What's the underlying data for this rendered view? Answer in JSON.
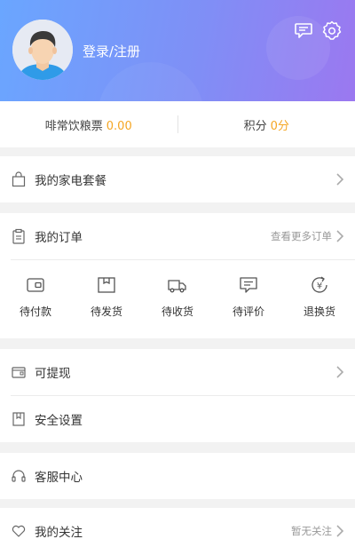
{
  "header": {
    "login_label": "登录/注册"
  },
  "stats": {
    "coupon_label": "啡常饮粮票",
    "coupon_value": "0.00",
    "points_label": "积分",
    "points_value": "0分"
  },
  "menu": {
    "appliance_package": "我的家电套餐",
    "my_orders": "我的订单",
    "more_orders": "查看更多订单",
    "withdrawable": "可提现",
    "security": "安全设置",
    "customer_service": "客服中心",
    "my_follows": "我的关注",
    "no_follows": "暂无关注"
  },
  "order_status": [
    {
      "label": "待付款",
      "icon": "wallet-icon"
    },
    {
      "label": "待发货",
      "icon": "box-icon"
    },
    {
      "label": "待收货",
      "icon": "truck-icon"
    },
    {
      "label": "待评价",
      "icon": "comment-icon"
    },
    {
      "label": "退换货",
      "icon": "refund-icon"
    }
  ],
  "colors": {
    "accent": "#f5a623",
    "header_start": "#6aa6ff",
    "header_end": "#9b78f0"
  }
}
